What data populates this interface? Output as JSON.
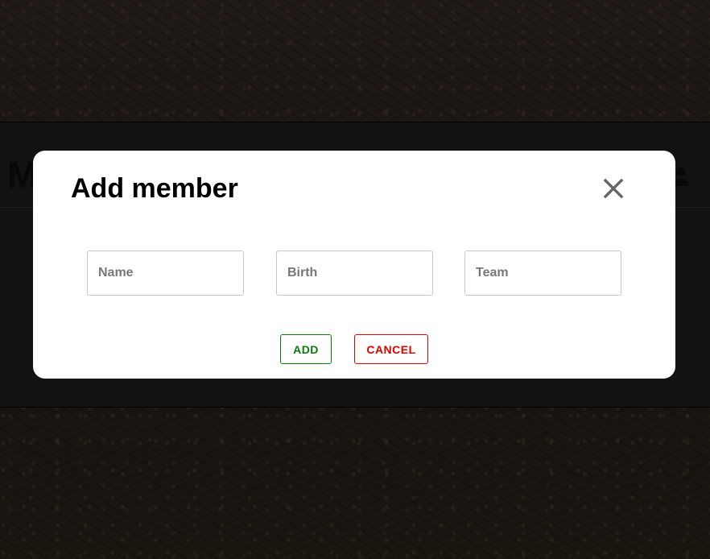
{
  "background": {
    "overlay_color": "#000000"
  },
  "app": {
    "title_partial": "M",
    "user_icon": "person-icon"
  },
  "modal": {
    "title": "Add member",
    "close_icon": "close-icon",
    "fields": {
      "name": {
        "placeholder": "Name",
        "value": ""
      },
      "birth": {
        "placeholder": "Birth",
        "value": ""
      },
      "team": {
        "placeholder": "Team",
        "value": ""
      }
    },
    "buttons": {
      "add": "ADD",
      "cancel": "CANCEL"
    }
  },
  "colors": {
    "add": "#087B08",
    "cancel": "#E00000",
    "modal_background": "#FFFFFF"
  }
}
